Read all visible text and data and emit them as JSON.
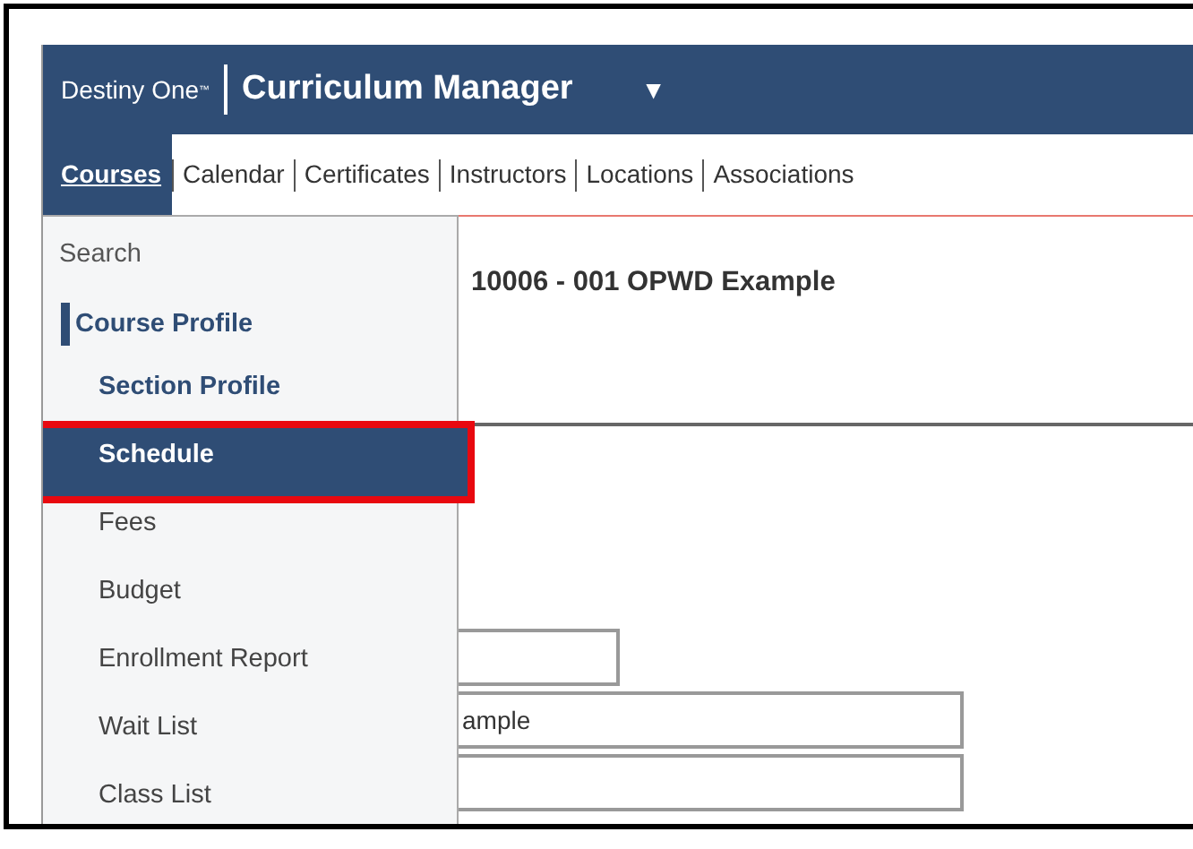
{
  "header": {
    "brand": "Destiny One",
    "brand_mark": "™",
    "title": "Curriculum Manager",
    "caret": "▼"
  },
  "nav": [
    {
      "label": "Courses",
      "selected": true
    },
    {
      "label": "Calendar",
      "selected": false
    },
    {
      "label": "Certificates",
      "selected": false
    },
    {
      "label": "Instructors",
      "selected": false
    },
    {
      "label": "Locations",
      "selected": false
    },
    {
      "label": "Associations",
      "selected": false
    }
  ],
  "menu": [
    {
      "label": "Search",
      "kind": "top",
      "selected": false
    },
    {
      "label": "Course Profile",
      "kind": "current",
      "selected": false
    },
    {
      "label": "Section Profile",
      "kind": "section",
      "selected": false
    },
    {
      "label": "Schedule",
      "kind": "sub",
      "selected": true
    },
    {
      "label": "Fees",
      "kind": "sub",
      "selected": false
    },
    {
      "label": "Budget",
      "kind": "sub",
      "selected": false
    },
    {
      "label": "Enrollment Report",
      "kind": "sub",
      "selected": false
    },
    {
      "label": "Wait List",
      "kind": "sub",
      "selected": false
    },
    {
      "label": "Class List",
      "kind": "sub",
      "selected": false
    }
  ],
  "page_title": "10006 - 001 OPWD Example",
  "fields": [
    {
      "kind": "short"
    },
    {
      "kind": "long",
      "value": "ample"
    },
    {
      "kind": "long"
    }
  ]
}
